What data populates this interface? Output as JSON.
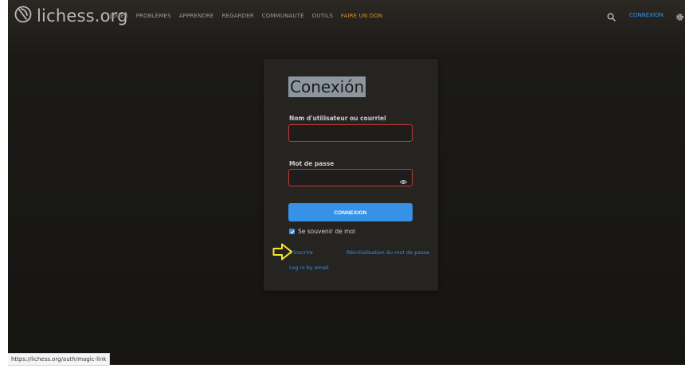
{
  "header": {
    "logo_text": "lichess.org",
    "nav": [
      "JOUER",
      "PROBLÈMES",
      "APPRENDRE",
      "REGARDER",
      "COMMUNAUTÉ",
      "OUTILS",
      "FAIRE UN DON"
    ],
    "connexion": "CONNEXION",
    "icons": [
      "knight-logo-icon",
      "search-icon",
      "gear-icon"
    ]
  },
  "login": {
    "title": "Conexión",
    "username_label": "Nom d'utilisateur ou courriel",
    "username_value": "",
    "password_label": "Mot de passe",
    "password_value": "",
    "submit_label": "CONNEXION",
    "remember_label": "Se souvenir de moi",
    "remember_checked": true,
    "signup_link": "S'inscrire",
    "reset_link": "Réinitialisation du mot de passe",
    "email_link": "Log in by email"
  },
  "status_url": "https://lichess.org/auth/magic-link",
  "colors": {
    "accent": "#3692e7",
    "donate": "#d59120",
    "error_border": "#c23b34",
    "annotation_arrow": "#f5e82a"
  }
}
